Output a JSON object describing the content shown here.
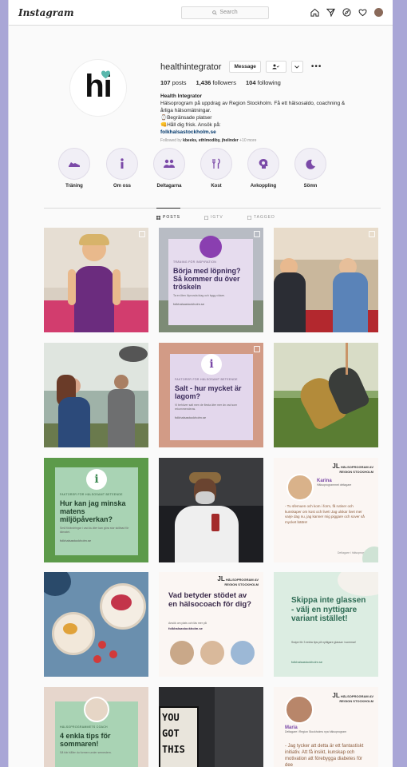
{
  "nav": {
    "logo": "Instagram",
    "search_placeholder": "Search"
  },
  "profile": {
    "username": "healthintegrator",
    "message_label": "Message",
    "stats": {
      "posts": "107",
      "posts_label": "posts",
      "followers": "1,436",
      "followers_label": "followers",
      "following": "104",
      "following_label": "following"
    },
    "bio_name": "Health Integrator",
    "bio_line1": "Hälsoprogram på uppdrag av Region Stockholm. Få ett hälsosaldo, coachning &",
    "bio_line2": "årliga hälsomätningar.",
    "bio_line3": "⌚Begränsade platser",
    "bio_line4": "👊Håll dig frisk. Ansök på:",
    "bio_link": "folkhalsastockholm.se",
    "followed_prefix": "Followed by",
    "followed_names": "kbeeks, ethlmodiby, jhelinder",
    "followed_more": "+10 more"
  },
  "highlights": [
    {
      "label": "Träning",
      "icon": "shoe-icon"
    },
    {
      "label": "Om oss",
      "icon": "info-icon"
    },
    {
      "label": "Deltagarna",
      "icon": "people-icon"
    },
    {
      "label": "Kost",
      "icon": "cutlery-icon"
    },
    {
      "label": "Avkoppling",
      "icon": "mind-icon"
    },
    {
      "label": "Sömn",
      "icon": "moon-icon"
    }
  ],
  "tabs": {
    "posts": "POSTS",
    "igtv": "IGTV",
    "tagged": "TAGGED"
  },
  "posts": {
    "p2": {
      "kicker": "TRÄNING FÖR INSPIRATION",
      "title": "Börja med löpning? Så kommer du över tröskeln",
      "small": "Ta en liten löprunda idag och bygg vidare.",
      "url": "folkhalsastockholm.se"
    },
    "p5": {
      "kicker": "FAKTORER FÖR HÄLSOSAMT BETEENDE",
      "title": "Salt - hur mycket är lagom?",
      "small": "Vi behöver salt men de flesta äter mer än vad som rekommenderas.",
      "url": "folkhalsastockholm.se"
    },
    "p7": {
      "kicker": "FAKTORER FÖR HÄLSOSAMT BETEENDE",
      "title": "Hur kan jag minska matens miljöpåverkan?",
      "small": "Små förändringar i vad du äter kan göra stor skillnad för klimatet.",
      "url": "folkhalsastockholm.se"
    },
    "p9": {
      "brand": "HÄLSOPROGRAM AV REGION STOCKHOLM",
      "name": "Karina",
      "role": "Hälsoprogrammet deltagare",
      "quote": "- Tu sfemuen och kom i form, få rutiner och kunskaper om kost och livet! Jag ulskar livet mer varje dag nu, jag kanner mig piggare och sover så mycket bättre!",
      "sig": "Deltagare i hälsoprogrammet"
    },
    "p11": {
      "brand": "HÄLSOPROGRAM AV REGION STOCKHOLM",
      "title": "Vad betyder stödet av en hälsocoach för dig?",
      "small": "Ansök om plats och läs mer på",
      "url": "folkhalsastockholm.se"
    },
    "p12": {
      "title": "Skippa inte glassen - välj en nyttigare variant istället!",
      "small": "Swipe för 3 enkla tips på nyttigare glassar i sommar!",
      "url": "folkhalsastockholm.se"
    },
    "p13": {
      "kicker": "HÄLSOPROGRAMMETS COACH",
      "title": "4 enkla tips för sommaren!",
      "small": "Så här håller du formen under semestern."
    },
    "p14": {
      "text": "YOU GOT THIS"
    },
    "p15": {
      "brand": "HÄLSOPROGRAM AV REGION STOCKHOLM",
      "name": "Maria",
      "role": "Deltagare i Region Stockholms nya hälsoprogram",
      "quote": "- Jag tycker att detta är ett fantastiskt initiativ. Att få insikt, kunskap och motivation att förebygga diabetes för dee"
    }
  },
  "colors": {
    "accent": "#8a5bb6",
    "link": "#00376b",
    "teal": "#5ab8ad",
    "green_card": "#a9d3b4",
    "lavender_card": "#e0d6ee",
    "page_bg": "#a9a6d6"
  }
}
